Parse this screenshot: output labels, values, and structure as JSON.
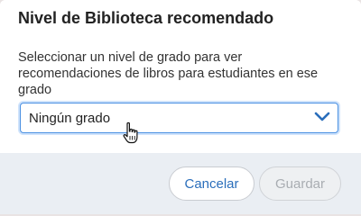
{
  "dialog": {
    "title": "Nivel de Biblioteca recomendado",
    "description": "Seleccionar un nivel de grado para ver recomendaciones de libros para estudiantes en ese grado",
    "grade_select": {
      "selected_value": "Ningún grado",
      "icon": "chevron-down-icon"
    },
    "footer": {
      "cancel_label": "Cancelar",
      "save_label": "Guardar",
      "save_enabled": false
    }
  },
  "colors": {
    "accent": "#4a90e2",
    "link_text": "#2a6ebb",
    "footer_bg": "#eaeef3"
  }
}
